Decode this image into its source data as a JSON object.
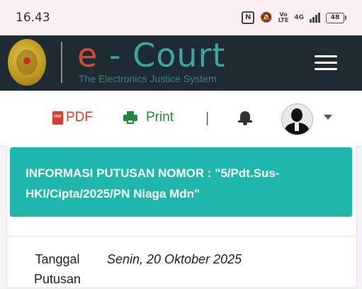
{
  "status_bar": {
    "time": "16.43",
    "nfc": "N",
    "network_top": "Vo",
    "network_bottom": "LTE",
    "gen": "4G",
    "battery": "48"
  },
  "header": {
    "brand_e": "e",
    "brand_rest": " - Court",
    "tagline": "The Electronics Justice System"
  },
  "toolbar": {
    "pdf_label": "PDF",
    "print_label": "Print",
    "separator": "|"
  },
  "banner": {
    "title": "INFORMASI PUTUSAN NOMOR : \"5/Pdt.Sus-HKI/Cipta/2025/PN Niaga Mdn\""
  },
  "detail_rows": [
    {
      "label": "Tanggal Putusan",
      "value": "Senin, 20 Oktober 2025"
    }
  ],
  "colors": {
    "header_bg": "#1f2b33",
    "brand_teal": "#3aa6a0",
    "brand_red": "#d8472f",
    "banner_teal": "#1fb7ad",
    "pdf_red": "#e03b2f",
    "print_green": "#1e8a3c"
  },
  "icons": {
    "pdf": "file-pdf-icon",
    "print": "printer-icon",
    "bell": "bell-icon",
    "menu": "hamburger-menu-icon",
    "caret": "chevron-down-icon"
  }
}
